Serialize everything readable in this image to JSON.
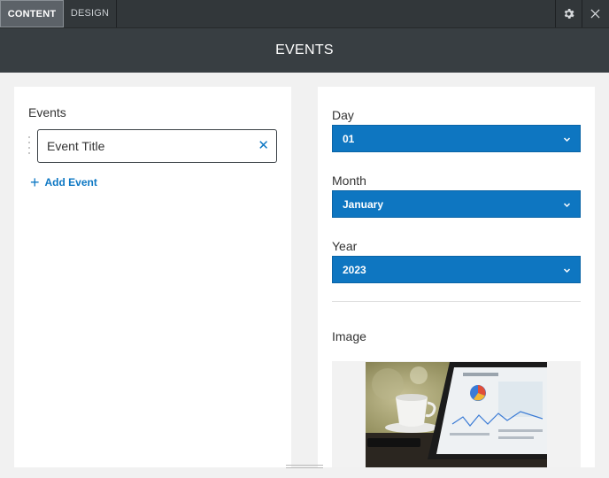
{
  "tabs": {
    "content": "CONTENT",
    "design": "DESIGN"
  },
  "header": {
    "title": "EVENTS"
  },
  "events_panel": {
    "label": "Events",
    "items": [
      {
        "title": "Event Title"
      }
    ],
    "add_label": "Add Event"
  },
  "date_fields": {
    "day": {
      "label": "Day",
      "value": "01"
    },
    "month": {
      "label": "Month",
      "value": "January"
    },
    "year": {
      "label": "Year",
      "value": "2023"
    }
  },
  "image_field": {
    "label": "Image"
  },
  "colors": {
    "accent": "#0e76c1",
    "topbar": "#32373a",
    "titlebar": "#383e42"
  },
  "icons": [
    "gear-icon",
    "close-icon",
    "remove-icon",
    "plus-icon",
    "chevron-down-icon",
    "drag-handle-icon"
  ]
}
